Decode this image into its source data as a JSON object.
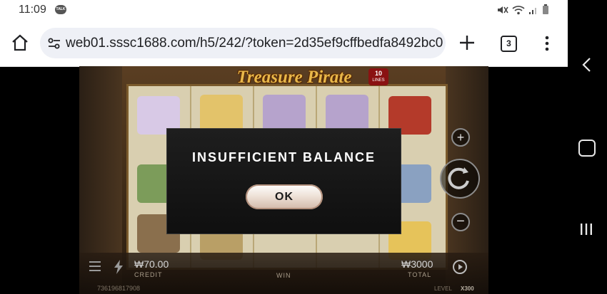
{
  "status": {
    "time": "11:09",
    "talk_badge": "TALK",
    "icons": [
      "mute-icon",
      "wifi-icon",
      "signal-icon",
      "battery-icon"
    ]
  },
  "browser": {
    "url": "web01.sssc1688.com/h5/242/?token=2d35ef9cffbedfa8492bc0",
    "tab_count": "3",
    "icons": [
      "home-icon",
      "site-settings-icon",
      "plus-icon",
      "menu-dots-icon"
    ]
  },
  "game": {
    "logo": "Treasure Pirate",
    "lines_badge": {
      "top": "10",
      "bottom": "LINES"
    },
    "credit_amount": "₩70.00",
    "credit_label": "CREDIT",
    "win_label": "WIN",
    "total_amount": "₩3000",
    "total_label": "TOTAL",
    "player_id": "736196817908",
    "level_label": "LEVEL",
    "level_value": "X300"
  },
  "dialog": {
    "message": "INSUFFICIENT BALANCE",
    "ok_label": "OK"
  },
  "colors": {
    "dialog_bg": "#141414",
    "ok_button": "#efe3d9",
    "browser_bg": "#ffffff",
    "url_pill": "#eef0f6"
  }
}
